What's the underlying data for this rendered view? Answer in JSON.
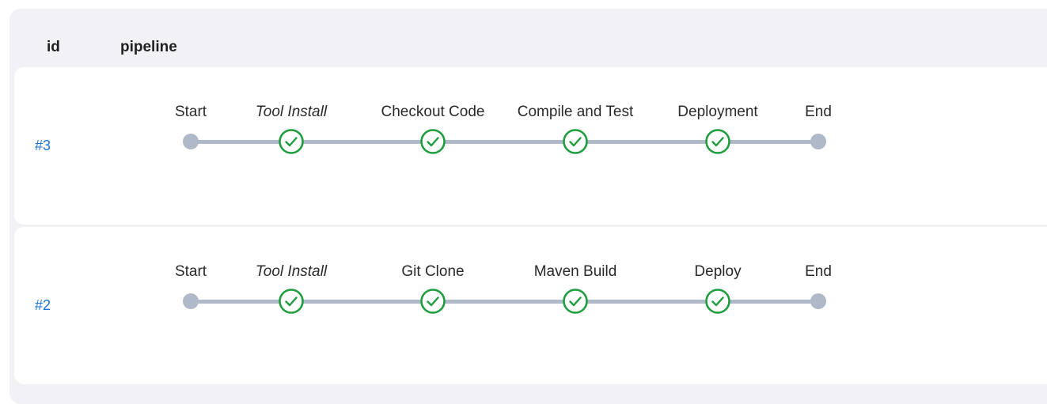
{
  "header": {
    "id_label": "id",
    "pipeline_label": "pipeline"
  },
  "colors": {
    "success": "#1f9d3f",
    "node": "#b0b9c8",
    "link": "#1a73d9"
  },
  "runs": [
    {
      "id": "#3",
      "stages": [
        {
          "label": "Start",
          "type": "start",
          "italic": false,
          "icon": "dot"
        },
        {
          "label": "Tool Install",
          "type": "stage",
          "italic": true,
          "icon": "check-circle-icon",
          "status": "success"
        },
        {
          "label": "Checkout Code",
          "type": "stage",
          "italic": false,
          "icon": "check-circle-icon",
          "status": "success"
        },
        {
          "label": "Compile and Test",
          "type": "stage",
          "italic": false,
          "icon": "check-circle-icon",
          "status": "success"
        },
        {
          "label": "Deployment",
          "type": "stage",
          "italic": false,
          "icon": "check-circle-icon",
          "status": "success"
        },
        {
          "label": "End",
          "type": "end",
          "italic": false,
          "icon": "dot"
        }
      ]
    },
    {
      "id": "#2",
      "stages": [
        {
          "label": "Start",
          "type": "start",
          "italic": false,
          "icon": "dot"
        },
        {
          "label": "Tool Install",
          "type": "stage",
          "italic": true,
          "icon": "check-circle-icon",
          "status": "success"
        },
        {
          "label": "Git Clone",
          "type": "stage",
          "italic": false,
          "icon": "check-circle-icon",
          "status": "success"
        },
        {
          "label": "Maven Build",
          "type": "stage",
          "italic": false,
          "icon": "check-circle-icon",
          "status": "success"
        },
        {
          "label": "Deploy",
          "type": "stage",
          "italic": false,
          "icon": "check-circle-icon",
          "status": "success"
        },
        {
          "label": "End",
          "type": "end",
          "italic": false,
          "icon": "dot"
        }
      ]
    }
  ]
}
